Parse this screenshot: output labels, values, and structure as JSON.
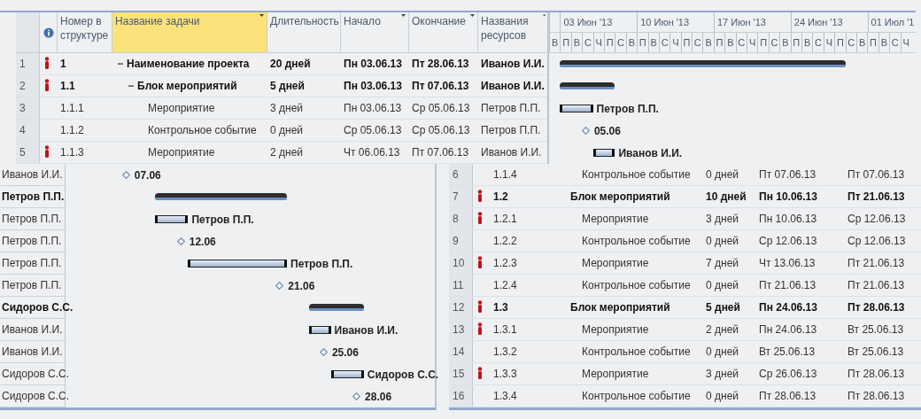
{
  "top": {
    "columns": [
      {
        "label": "Номер в структуре",
        "selected": false
      },
      {
        "label": "Название задачи",
        "selected": true
      },
      {
        "label": "Длительность",
        "selected": false
      },
      {
        "label": "Начало",
        "selected": false
      },
      {
        "label": "Окончание",
        "selected": false
      },
      {
        "label": "Названия ресурсов",
        "selected": false
      }
    ],
    "timescale": {
      "weeks": [
        "03 Июн '13",
        "10 Июн '13",
        "17 Июн '13",
        "24 Июн '13",
        "01 Июл '1"
      ],
      "days": [
        "В",
        "П",
        "В",
        "С",
        "Ч",
        "П",
        "С",
        "В",
        "П",
        "В",
        "С",
        "Ч",
        "П",
        "С",
        "В",
        "П",
        "В",
        "С",
        "Ч",
        "П",
        "С",
        "В",
        "П",
        "В",
        "С",
        "Ч",
        "П",
        "С",
        "В",
        "П",
        "В",
        "С",
        "Ч"
      ]
    },
    "tasks": [
      {
        "id": "1",
        "indicator": true,
        "wbs": "1",
        "name": "Наименование проекта",
        "summary": true,
        "expanded": true,
        "duration": "20 дней",
        "start": "Пн 03.06.13",
        "finish": "Пт 28.06.13",
        "resource": "Иванов И.И.",
        "bar": {
          "kind": "summary"
        },
        "children": [
          {
            "id": "2",
            "indicator": true,
            "wbs": "1.1",
            "name": "Блок мероприятий",
            "summary": true,
            "expanded": true,
            "duration": "5 дней",
            "start": "Пн 03.06.13",
            "finish": "Пт 07.06.13",
            "resource": "Иванов И.И.",
            "bar": {
              "kind": "summary"
            },
            "children": [
              {
                "id": "3",
                "indicator": false,
                "wbs": "1.1.1",
                "name": "Мероприятие",
                "summary": false,
                "duration": "3 дней",
                "start": "Пн 03.06.13",
                "finish": "Ср 05.06.13",
                "resource": "Петров П.П.",
                "bar": {
                  "kind": "task",
                  "label": "Петров П.П."
                }
              },
              {
                "id": "4",
                "indicator": false,
                "wbs": "1.1.2",
                "name": "Контрольное событие",
                "summary": false,
                "duration": "0 дней",
                "start": "Ср 05.06.13",
                "finish": "Ср 05.06.13",
                "resource": "Петров П.П.",
                "bar": {
                  "kind": "milestone",
                  "label": "05.06"
                }
              },
              {
                "id": "5",
                "indicator": true,
                "wbs": "1.1.3",
                "name": "Мероприятие",
                "summary": false,
                "duration": "2 дней",
                "start": "Чт 06.06.13",
                "finish": "Пт 07.06.13",
                "resource": "Иванов И.И.",
                "bar": {
                  "kind": "task",
                  "label": "Иванов И.И."
                }
              }
            ]
          }
        ]
      }
    ]
  },
  "bottom_left": {
    "rows": [
      {
        "resource": "Иванов И.И.",
        "bar": {
          "kind": "milestone",
          "label": "07.06"
        }
      },
      {
        "resource": "Петров П.П.",
        "bar": {
          "kind": "summary"
        }
      },
      {
        "resource": "Петров П.П.",
        "bar": {
          "kind": "task",
          "label": "Петров П.П."
        }
      },
      {
        "resource": "Петров П.П.",
        "bar": {
          "kind": "milestone",
          "label": "12.06"
        }
      },
      {
        "resource": "Петров П.П.",
        "bar": {
          "kind": "task",
          "label": "Петров П.П."
        }
      },
      {
        "resource": "Петров П.П.",
        "bar": {
          "kind": "milestone",
          "label": "21.06"
        }
      },
      {
        "resource": "Сидоров С.С.",
        "bar": {
          "kind": "summary"
        }
      },
      {
        "resource": "Иванов И.И.",
        "bar": {
          "kind": "task",
          "label": "Иванов И.И."
        }
      },
      {
        "resource": "Иванов И.И.",
        "bar": {
          "kind": "milestone",
          "label": "25.06"
        }
      },
      {
        "resource": "Сидоров С.С.",
        "bar": {
          "kind": "task",
          "label": "Сидоров С.С."
        }
      },
      {
        "resource": "Сидоров С.С.",
        "bar": {
          "kind": "milestone",
          "label": "28.06"
        }
      }
    ]
  },
  "bottom_right": {
    "rows": [
      {
        "id": "6",
        "indicator": false,
        "wbs": "1.1.4",
        "name": "Контрольное событие",
        "summary": false,
        "duration": "0 дней",
        "start": "Пт 07.06.13",
        "finish": "Пт 07.06.13"
      },
      {
        "id": "7",
        "indicator": true,
        "wbs": "1.2",
        "name": "Блок мероприятий",
        "summary": true,
        "duration": "10 дней",
        "start": "Пн 10.06.13",
        "finish": "Пт 21.06.13"
      },
      {
        "id": "8",
        "indicator": true,
        "wbs": "1.2.1",
        "name": "Мероприятие",
        "summary": false,
        "duration": "3 дней",
        "start": "Пн 10.06.13",
        "finish": "Ср 12.06.13"
      },
      {
        "id": "9",
        "indicator": false,
        "wbs": "1.2.2",
        "name": "Контрольное событие",
        "summary": false,
        "duration": "0 дней",
        "start": "Ср 12.06.13",
        "finish": "Ср 12.06.13"
      },
      {
        "id": "10",
        "indicator": true,
        "wbs": "1.2.3",
        "name": "Мероприятие",
        "summary": false,
        "duration": "7 дней",
        "start": "Чт 13.06.13",
        "finish": "Пт 21.06.13"
      },
      {
        "id": "11",
        "indicator": false,
        "wbs": "1.2.4",
        "name": "Контрольное событие",
        "summary": false,
        "duration": "0 дней",
        "start": "Пт 21.06.13",
        "finish": "Пт 21.06.13"
      },
      {
        "id": "12",
        "indicator": true,
        "wbs": "1.3",
        "name": "Блок мероприятий",
        "summary": true,
        "duration": "5 дней",
        "start": "Пн 24.06.13",
        "finish": "Пт 28.06.13"
      },
      {
        "id": "13",
        "indicator": true,
        "wbs": "1.3.1",
        "name": "Мероприятие",
        "summary": false,
        "duration": "2 дней",
        "start": "Пн 24.06.13",
        "finish": "Вт 25.06.13"
      },
      {
        "id": "14",
        "indicator": false,
        "wbs": "1.3.2",
        "name": "Контрольное событие",
        "summary": false,
        "duration": "0 дней",
        "start": "Вт 25.06.13",
        "finish": "Вт 25.06.13"
      },
      {
        "id": "15",
        "indicator": true,
        "wbs": "1.3.3",
        "name": "Мероприятие",
        "summary": false,
        "duration": "3 дней",
        "start": "Ср 26.06.13",
        "finish": "Пт 28.06.13"
      },
      {
        "id": "16",
        "indicator": false,
        "wbs": "1.3.4",
        "name": "Контрольное событие",
        "summary": false,
        "duration": "0 дней",
        "start": "Пт 28.06.13",
        "finish": "Пт 28.06.13"
      }
    ]
  }
}
